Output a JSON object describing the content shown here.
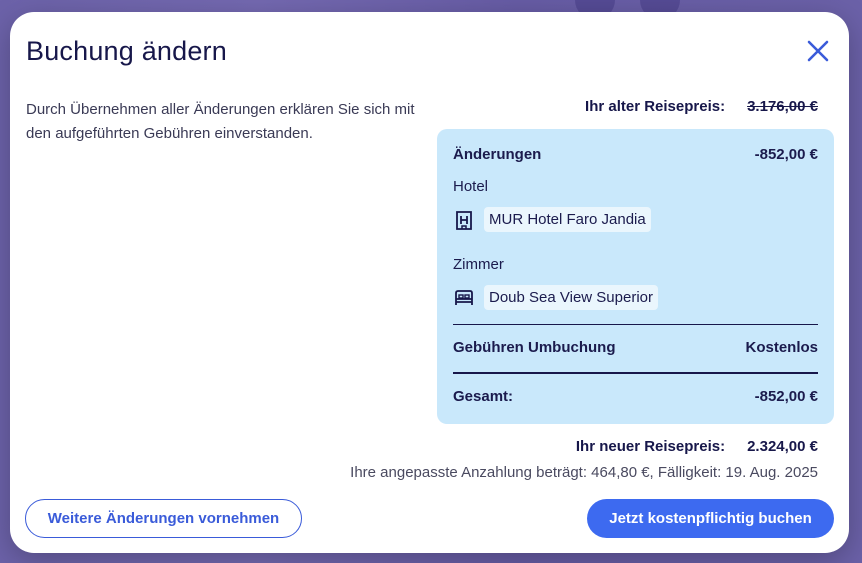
{
  "modal": {
    "title": "Buchung ändern",
    "description": "Durch Übernehmen aller Änderungen erklären Sie sich mit den aufgeführten Gebühren einverstanden.",
    "close_icon": "close-icon"
  },
  "old_price": {
    "label": "Ihr alter Reisepreis:",
    "value": "3.176,00 €"
  },
  "changes": {
    "label": "Änderungen",
    "amount": "-852,00 €",
    "hotel": {
      "label": "Hotel",
      "icon": "hotel-icon",
      "value": "MUR Hotel Faro Jandia"
    },
    "room": {
      "label": "Zimmer",
      "icon": "bed-icon",
      "value": "Doub Sea View Superior"
    },
    "fee": {
      "label": "Gebühren Umbuchung",
      "value": "Kostenlos"
    },
    "total": {
      "label": "Gesamt:",
      "value": "-852,00 €"
    }
  },
  "new_price": {
    "label": "Ihr neuer Reisepreis:",
    "value": "2.324,00 €"
  },
  "deposit_text": "Ihre angepasste Anzahlung beträgt: 464,80 €, Fälligkeit: 19. Aug. 2025",
  "buttons": {
    "more_changes": "Weitere Änderungen vornehmen",
    "book": "Jetzt kostenpflichtig buchen"
  },
  "colors": {
    "accent": "#3d6af0",
    "card_bg": "#c9e8fb",
    "text_dark": "#17174a"
  }
}
